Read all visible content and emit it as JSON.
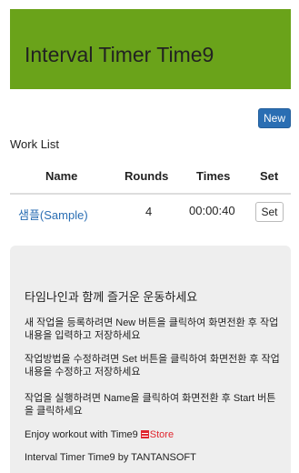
{
  "header": {
    "title": "Interval Timer Time9"
  },
  "toolbar": {
    "new_label": "New"
  },
  "worklist": {
    "title": "Work List",
    "columns": [
      "Name",
      "Rounds",
      "Times",
      "Set"
    ],
    "rows": [
      {
        "name": "샘플(Sample)",
        "rounds": "4",
        "times": "00:00:40",
        "set_label": "Set"
      }
    ]
  },
  "info": {
    "lead": "타임나인과 함께 즐거운 운동하세요",
    "p1": "새 작업을 등록하려면 New 버튼을 클릭하여 화면전환 후 작업내용을 입력하고 저장하세요",
    "p2": "작업방법을 수정하려면 Set 버튼을 클릭하여 화면전환 후 작업내용을 수정하고 저장하세요",
    "p3": "작업을 실행하려면 Name을 클릭하여 화면전환 후 Start 버튼을 클릭하세요",
    "enjoy": "Enjoy workout with Time9",
    "store_label": "Store",
    "footer": "Interval Timer Time9 by TANTANSOFT"
  },
  "colors": {
    "header_bg": "#6aa31a",
    "primary": "#2a6eb3",
    "store_red": "#e0262f",
    "panel_bg": "#eeeeee"
  },
  "icons": {
    "store": "store-icon"
  }
}
